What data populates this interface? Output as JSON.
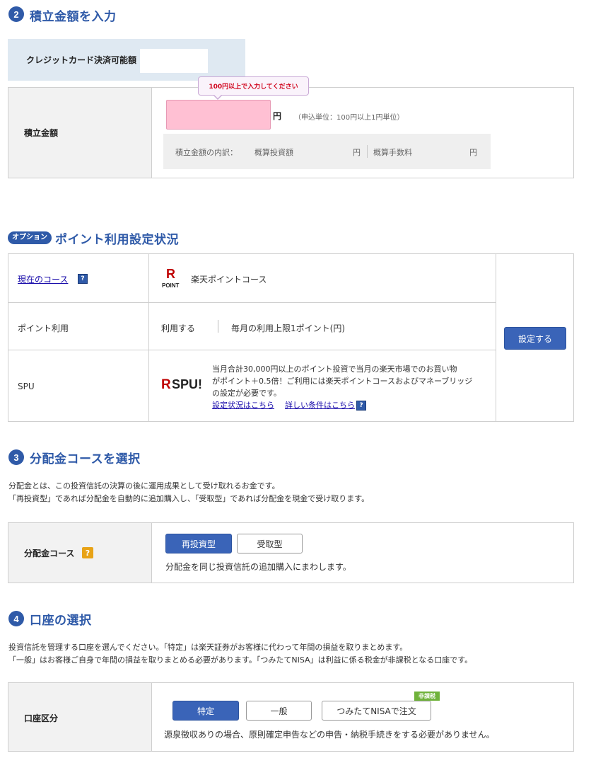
{
  "section2": {
    "num": "2",
    "title": "積立金額を入力",
    "credit_label": "クレジットカード決済可能額",
    "amount_label": "積立金額",
    "tooltip": "100円以上で入力してください",
    "amount_value": "",
    "yen": "円",
    "unit_note": "（申込単位：100円以上1円単位）",
    "breakdown_label": "積立金額の内訳：",
    "invest_label": "概算投資額",
    "invest_yen": "円",
    "fee_label": "概算手数料",
    "fee_yen": "円"
  },
  "option": {
    "badge": "オプション",
    "title": "ポイント利用設定状況",
    "course_label": "現在のコース",
    "course_logo_r": "R",
    "course_logo_point": "POINT",
    "course_value": "楽天ポイントコース",
    "point_use_label": "ポイント利用",
    "point_use_value": "利用する",
    "point_limit": "毎月の利用上限1ポイント(円)",
    "spu_label": "SPU",
    "spu_logo": "SPU!",
    "spu_logo_r": "R",
    "spu_text1": "当月合計30,000円以上のポイント投資で当月の楽天市場でのお買い物",
    "spu_text2": "がポイント＋0.5倍！ご利用には楽天ポイントコースおよびマネーブリッジ",
    "spu_text3": "の設定が必要です。",
    "spu_link1": "設定状況はこちら",
    "spu_link2": "詳しい条件はこちら",
    "settings_button": "設定する"
  },
  "section3": {
    "num": "3",
    "title": "分配金コースを選択",
    "desc1": "分配金とは、この投資信託の決算の後に運用成果として受け取れるお金です。",
    "desc2": "「再投資型」であれば分配金を自動的に追加購入し、「受取型」であれば分配金を現金で受け取ります。",
    "course_label": "分配金コース",
    "help": "?",
    "reinvest": "再投資型",
    "receive": "受取型",
    "note": "分配金を同じ投資信託の追加購入にまわします。"
  },
  "section4": {
    "num": "4",
    "title": "口座の選択",
    "desc1": "投資信託を管理する口座を選んでください。「特定」は楽天証券がお客様に代わって年間の損益を取りまとめます。",
    "desc2": "「一般」はお客様ご自身で年間の損益を取りまとめる必要があります。「つみたてNISA」は利益に係る税金が非課税となる口座です。",
    "account_label": "口座区分",
    "tokutei": "特定",
    "ippan": "一般",
    "nisa": "つみたてNISAで注文",
    "tax_free_badge": "非課税",
    "note": "源泉徴収ありの場合、原則確定申告などの申告・納税手続きをする必要がありません。"
  },
  "colors": {
    "accent": "#2f5aa8",
    "button": "#3a64b8",
    "input_error": "#ffc0d3",
    "tooltip_text": "#d0021b",
    "badge_green": "#6fb23a",
    "help_yellow": "#e8a317",
    "rakuten_red": "#bf0000"
  }
}
